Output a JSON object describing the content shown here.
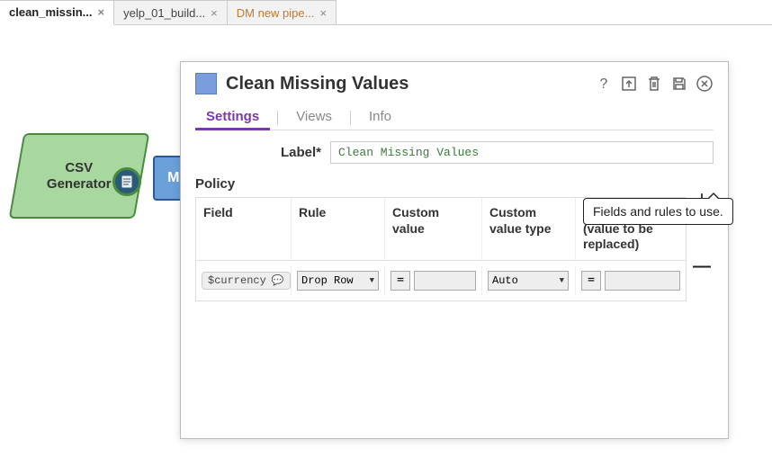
{
  "tabs": [
    {
      "label": "clean_missin...",
      "closeable": true,
      "active": true
    },
    {
      "label": "yelp_01_build...",
      "closeable": true,
      "active": false
    },
    {
      "label": "DM new pipe...",
      "closeable": true,
      "active": false,
      "orange": true
    }
  ],
  "close_glyph": "×",
  "canvas": {
    "csv_label_1": "CSV",
    "csv_label_2": "Generator",
    "mi_label": "Mi"
  },
  "panel": {
    "title": "Clean Missing Values",
    "tabs": [
      "Settings",
      "Views",
      "Info"
    ],
    "label_field": "Label*",
    "label_value": "Clean Missing Values",
    "policy_heading": "Policy",
    "headers": {
      "field": "Field",
      "rule": "Rule",
      "custom_value": "Custom value",
      "custom_value_type": "Custom value type",
      "custom_value2": "Custom value (value to be replaced)"
    },
    "row": {
      "field": "$currency",
      "rule": "Drop Row",
      "custom_value": "",
      "custom_value_type": "Auto",
      "custom_value2": "",
      "eq": "="
    },
    "tooltip": "Fields and rules to use.",
    "plus": "+",
    "minus": "—"
  }
}
